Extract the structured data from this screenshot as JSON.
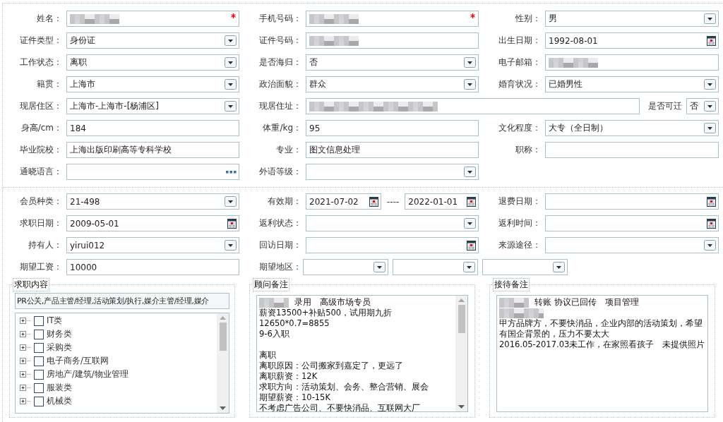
{
  "basic_info": {
    "fields": [
      {
        "label": "姓名：",
        "kind": "text",
        "redacted": true,
        "required": true
      },
      {
        "label": "手机号码：",
        "kind": "text",
        "redacted": true,
        "required": true
      },
      {
        "label": "性别：",
        "kind": "select",
        "value": "男"
      },
      {
        "label": "证件类型：",
        "kind": "select",
        "value": "身份证"
      },
      {
        "label": "证件号码：",
        "kind": "text",
        "redacted": true
      },
      {
        "label": "出生日期：",
        "kind": "date",
        "value": "1992-08-01"
      },
      {
        "label": "工作状态：",
        "kind": "select",
        "value": "离职"
      },
      {
        "label": "是否海归：",
        "kind": "select",
        "value": "否"
      },
      {
        "label": "电子邮箱：",
        "kind": "text",
        "redacted": true
      },
      {
        "label": "籍贯：",
        "kind": "select",
        "value": "上海市"
      },
      {
        "label": "政治面貌：",
        "kind": "select",
        "value": "群众"
      },
      {
        "label": "婚育状况：",
        "kind": "select",
        "value": "已婚男性"
      },
      {
        "label": "现居住区：",
        "kind": "select",
        "value": "上海市-上海市-[杨浦区]"
      },
      {
        "label": "现居住址：",
        "kind": "text",
        "redacted": true,
        "suffix": {
          "label": "是否可迁",
          "kind": "select",
          "value": "否"
        }
      },
      {
        "label": "身高/cm：",
        "kind": "text",
        "value": "184"
      },
      {
        "label": "体重/kg：",
        "kind": "text",
        "value": "95"
      },
      {
        "label": "文化程度：",
        "kind": "select",
        "value": "大专（全日制）"
      },
      {
        "label": "毕业院校：",
        "kind": "text",
        "value": "上海出版印刷高等专科学校"
      },
      {
        "label": "专业：",
        "kind": "text",
        "value": "图文信息处理"
      },
      {
        "label": "职称：",
        "kind": "text"
      },
      {
        "label": "通晓语言：",
        "kind": "lookup"
      },
      {
        "label": "外语等级：",
        "kind": "select"
      }
    ]
  },
  "membership": {
    "fields": [
      {
        "label": "会员种类：",
        "kind": "select",
        "value": "21-498"
      },
      {
        "label": "有效期：",
        "kind": "date_range",
        "values": [
          "2021-07-02",
          "2022-01-01"
        ],
        "separator": "----"
      },
      {
        "label": "退费日期：",
        "kind": "date"
      },
      {
        "label": "求职日期：",
        "kind": "date",
        "value": "2009-05-01"
      },
      {
        "label": "返利状态：",
        "kind": "select"
      },
      {
        "label": "返利时间：",
        "kind": "date"
      },
      {
        "label": "持有人：",
        "kind": "select",
        "value": "yirui012"
      },
      {
        "label": "回访日期：",
        "kind": "date"
      },
      {
        "label": "来源途径：",
        "kind": "select"
      },
      {
        "label": "期望工资：",
        "kind": "text",
        "value": "10000"
      },
      {
        "label": "期望地区：",
        "kind": "multi_select",
        "boxes": [
          {
            "kind": "select"
          },
          {
            "kind": "select"
          },
          {
            "kind": "select"
          }
        ]
      }
    ]
  },
  "job_panel": {
    "title": "求职内容",
    "selection": "PR公关,产品主管/经理,活动策划/执行,媒介主管/经理,媒介",
    "tree": [
      {
        "label": "IT类",
        "checked": false,
        "expanded": false
      },
      {
        "label": "财务类",
        "checked": false,
        "expanded": false
      },
      {
        "label": "采购类",
        "checked": false,
        "expanded": false
      },
      {
        "label": "电子商务/互联网",
        "checked": false,
        "expanded": false
      },
      {
        "label": "房地产/建筑/物业管理",
        "checked": false,
        "expanded": false
      },
      {
        "label": "服装类",
        "checked": false,
        "expanded": false
      },
      {
        "label": "机械类",
        "checked": false,
        "expanded": false
      }
    ]
  },
  "consultant_notes": {
    "title": "顾问备注",
    "scrollable": true,
    "blocks": [
      [
        {
          "redacted": true,
          "text": "录用　高级市场专员"
        },
        {
          "redacted": false,
          "text": "薪资13500+补贴500，试用期九折"
        },
        {
          "redacted": false,
          "text": "12650*0.7=8855"
        },
        {
          "redacted": false,
          "text": "9-6入职"
        }
      ],
      [
        {
          "redacted": false,
          "text": "离职"
        },
        {
          "redacted": false,
          "text": "离职原因：公司搬家到嘉定了，更远了"
        },
        {
          "redacted": false,
          "text": "离职薪资：12K"
        },
        {
          "redacted": false,
          "text": "求职方向：活动策划、会务、整合营销、展会"
        },
        {
          "redacted": false,
          "text": "期望薪资：10-15K"
        },
        {
          "redacted": false,
          "text": "不考虑广告公司、不要快消品、互联网大厂"
        }
      ]
    ]
  },
  "reception_notes": {
    "title": "接待备注",
    "scrollable": false,
    "blocks": [
      [
        {
          "redacted": true,
          "text": "转账 协议已回传　项目管理"
        },
        {
          "redacted": true
        },
        {
          "redacted": false,
          "text": "甲方品牌方，不要快消品，企业内部的活动策划，希望有国企背景的，压力不要太大"
        },
        {
          "redacted": false,
          "text": "2016.05-2017.03未工作，在家照看孩子　未提供照片"
        }
      ]
    ]
  }
}
